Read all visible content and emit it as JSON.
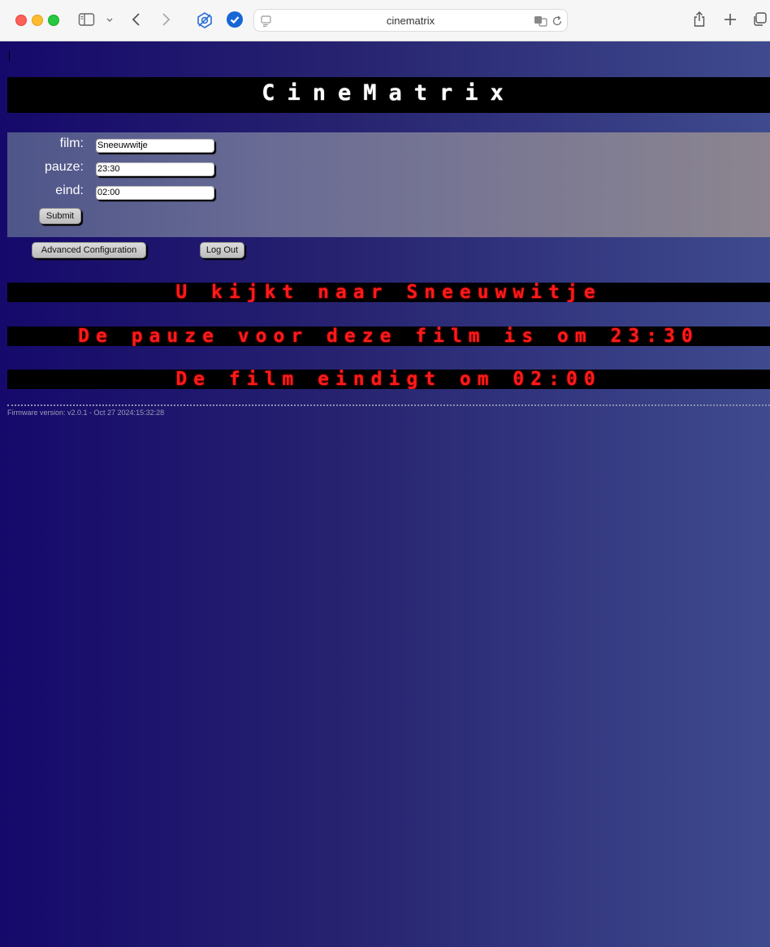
{
  "browser": {
    "url": "cinematrix"
  },
  "page": {
    "title": "CineMatrix",
    "form": {
      "film_label": "film:",
      "film_value": "Sneeuwwitje",
      "pauze_label": "pauze:",
      "pauze_value": "23:30",
      "eind_label": "eind:",
      "eind_value": "02:00",
      "submit_label": "Submit"
    },
    "advanced_label": "Advanced Configuration",
    "logout_label": "Log Out",
    "led_lines": [
      "U kijkt naar Sneeuwwitje",
      "De pauze voor deze film is om 23:30",
      "De film eindigt om 02:00"
    ],
    "firmware": "Firmware version: v2.0.1 - Oct 27 2024:15:32:28"
  },
  "colors": {
    "led_text": "#ff1a1a",
    "background_left": "#15096b",
    "background_right": "#3f4b8e"
  }
}
